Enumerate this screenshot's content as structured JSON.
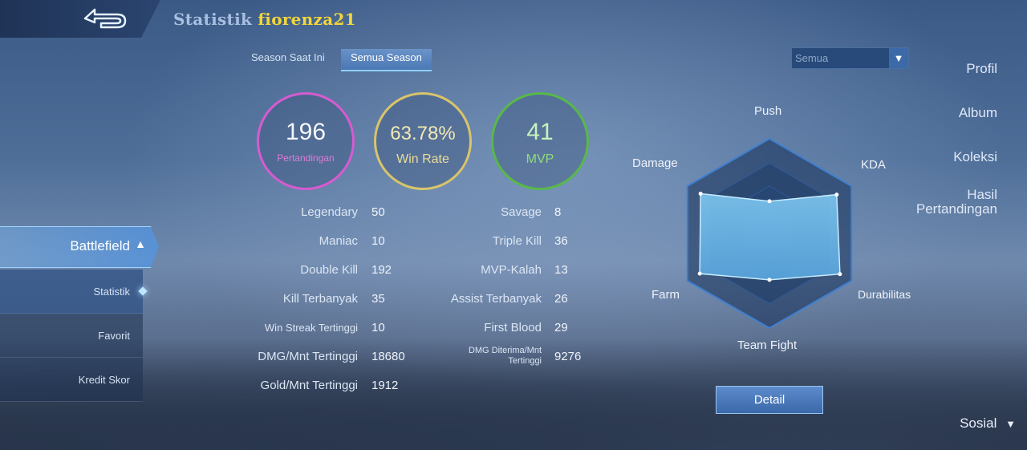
{
  "header": {
    "title": "Statistik",
    "username": "fiorenza21"
  },
  "sidebar": {
    "items": [
      {
        "label": "Profil"
      },
      {
        "label": "Album"
      },
      {
        "label": "Koleksi"
      },
      {
        "label": "Hasil",
        "label2": "Pertandingan"
      }
    ],
    "active": "Battlefield",
    "subitems": [
      {
        "label": "Statistik"
      },
      {
        "label": "Favorit"
      },
      {
        "label": "Kredit Skor"
      }
    ],
    "bottom": "Sosial"
  },
  "tabs": [
    {
      "label": "Season Saat Ini"
    },
    {
      "label": "Semua Season"
    }
  ],
  "filter": {
    "selected": "Semua"
  },
  "summary": [
    {
      "value": "196",
      "label": "Pertandingan",
      "color": "#d65bd0"
    },
    {
      "value": "63.78%",
      "label": "Win Rate",
      "color": "#d9c46a"
    },
    {
      "value": "41",
      "label": "MVP",
      "color": "#58b84a"
    }
  ],
  "stats_left": [
    {
      "label": "Legendary",
      "value": "50"
    },
    {
      "label": "Maniac",
      "value": "10"
    },
    {
      "label": "Double Kill",
      "value": "192"
    },
    {
      "label": "Kill Terbanyak",
      "value": "35"
    },
    {
      "label": "Win Streak Tertinggi",
      "value": "10"
    },
    {
      "label": "DMG/Mnt Tertinggi",
      "value": "18680"
    },
    {
      "label": "Gold/Mnt Tertinggi",
      "value": "1912"
    }
  ],
  "stats_right": [
    {
      "label": "Savage",
      "value": "8"
    },
    {
      "label": "Triple Kill",
      "value": "36"
    },
    {
      "label": "MVP-Kalah",
      "value": "13"
    },
    {
      "label": "Assist Terbanyak",
      "value": "26"
    },
    {
      "label": "First Blood",
      "value": "29"
    },
    {
      "label": "DMG Diterima/Mnt",
      "label2": "Tertinggi",
      "value": "9276"
    }
  ],
  "radar": {
    "labels": [
      "Push",
      "KDA",
      "Durabilitas",
      "Team Fight",
      "Farm",
      "Damage"
    ],
    "values": [
      0.34,
      0.82,
      0.86,
      0.49,
      0.85,
      0.84
    ]
  },
  "detail_button": "Detail"
}
